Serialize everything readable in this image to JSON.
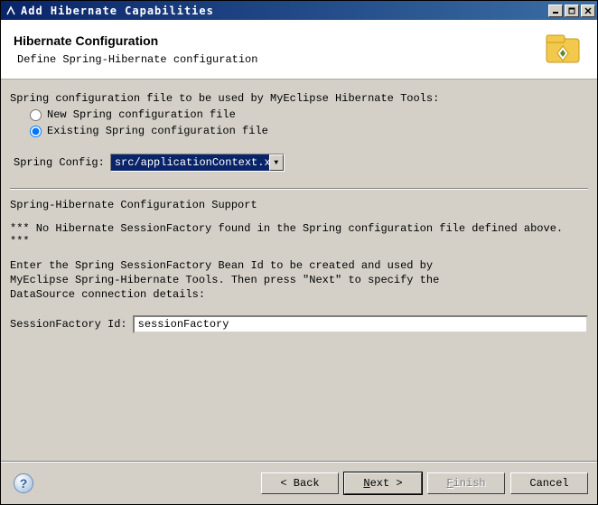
{
  "window": {
    "title": "Add Hibernate Capabilities"
  },
  "header": {
    "title": "Hibernate Configuration",
    "subtitle": "Define Spring-Hibernate configuration"
  },
  "body": {
    "intro": "Spring configuration file to be used by MyEclipse Hibernate Tools:",
    "radio_new": "New Spring configuration file",
    "radio_existing": "Existing Spring configuration file",
    "spring_config_label": "Spring Config:",
    "spring_config_value": "src/applicationContext.xml",
    "support_heading": "Spring-Hibernate Configuration Support",
    "warning": "*** No Hibernate SessionFactory found in the Spring configuration file defined above. ***",
    "instruction": "Enter the Spring SessionFactory Bean Id to be created and used by MyEclipse Spring-Hibernate Tools. Then press \"Next\" to specify the DataSource connection details:",
    "session_label": "SessionFactory Id:",
    "session_value": "sessionFactory"
  },
  "footer": {
    "back": "< Back",
    "next_pre": "N",
    "next_post": "ext >",
    "finish_pre": "F",
    "finish_post": "inish",
    "cancel": "Cancel"
  }
}
